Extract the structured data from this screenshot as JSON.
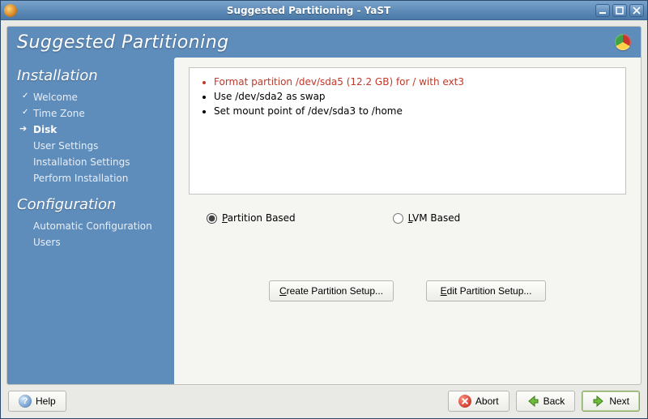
{
  "window": {
    "title": "Suggested Partitioning - YaST"
  },
  "header": {
    "title": "Suggested Partitioning"
  },
  "sidebar": {
    "section1_title": "Installation",
    "section1_items": [
      {
        "label": "Welcome",
        "state": "done"
      },
      {
        "label": "Time Zone",
        "state": "done"
      },
      {
        "label": "Disk",
        "state": "current"
      },
      {
        "label": "User Settings",
        "state": "pending"
      },
      {
        "label": "Installation Settings",
        "state": "pending"
      },
      {
        "label": "Perform Installation",
        "state": "pending"
      }
    ],
    "section2_title": "Configuration",
    "section2_items": [
      {
        "label": "Automatic Configuration",
        "state": "pending"
      },
      {
        "label": "Users",
        "state": "pending"
      }
    ]
  },
  "content": {
    "actions": [
      {
        "text": "Format partition /dev/sda5 (12.2 GB) for / with ext3",
        "highlight": true
      },
      {
        "text": "Use /dev/sda2 as swap",
        "highlight": false
      },
      {
        "text": "Set mount point of /dev/sda3 to /home",
        "highlight": false
      }
    ],
    "radio_partition_prefix": "P",
    "radio_partition_rest": "artition Based",
    "radio_lvm_prefix": "L",
    "radio_lvm_rest": "VM Based",
    "selected_radio": "partition",
    "create_btn_prefix": "C",
    "create_btn_rest": "reate Partition Setup...",
    "edit_btn_prefix": "E",
    "edit_btn_rest": "dit Partition Setup..."
  },
  "footer": {
    "help_prefix": "H",
    "help_rest": "elp",
    "abort_prefix": "",
    "abort_label_u": "r",
    "abort_label_pre": "Abo",
    "abort_label_post": "t",
    "back_prefix": "B",
    "back_rest": "ack",
    "next_prefix": "N",
    "next_rest": "ext"
  }
}
